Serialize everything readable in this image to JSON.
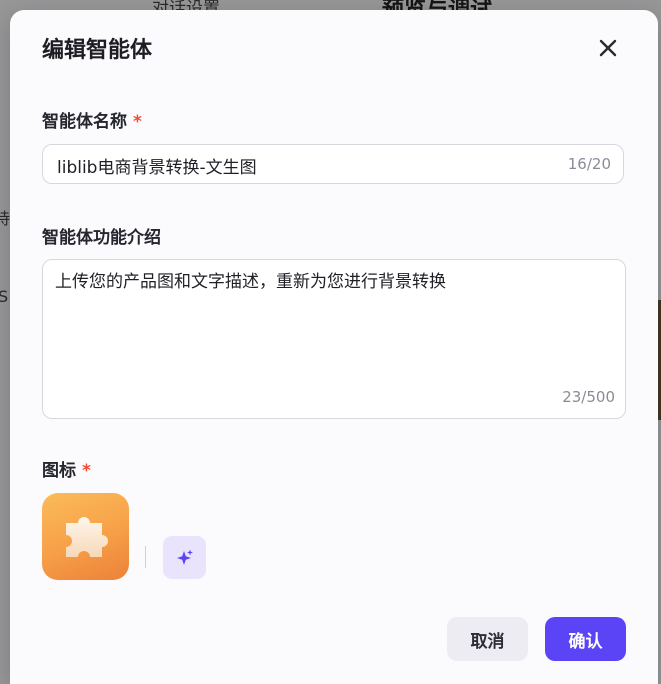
{
  "background": {
    "top_left_text": "对话设置",
    "top_right_text": "预览与调试",
    "side_char_1": "持",
    "side_char_2": "S"
  },
  "modal": {
    "title": "编辑智能体",
    "close_icon": "close-icon",
    "name_field": {
      "label": "智能体名称",
      "required_mark": "*",
      "value": "liblib电商背景转换-文生图",
      "counter": "16/20"
    },
    "description_field": {
      "label": "智能体功能介绍",
      "value": "上传您的产品图和文字描述，重新为您进行背景转换",
      "counter": "23/500"
    },
    "icon_field": {
      "label": "图标",
      "required_mark": "*",
      "icon": "puzzle-icon",
      "ai_generate_icon": "sparkle-icon"
    },
    "buttons": {
      "cancel": "取消",
      "confirm": "确认"
    },
    "colors": {
      "primary": "#5a44f5",
      "required": "#f04a36",
      "icon_gradient_start": "#fbbb5a",
      "icon_gradient_end": "#ec8238"
    }
  }
}
